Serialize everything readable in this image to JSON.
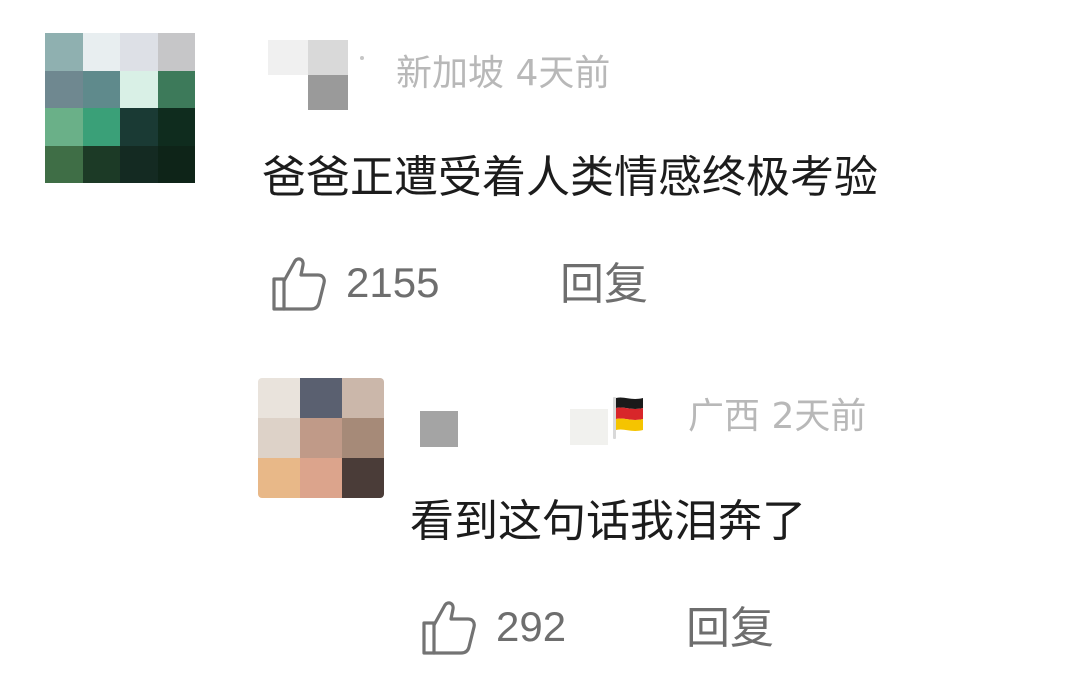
{
  "comments": [
    {
      "location": "新加坡",
      "time": "4天前",
      "text": "爸爸正遭受着人类情感终极考验",
      "likes": "2155",
      "reply_label": "回复"
    },
    {
      "location": "广西",
      "time": "2天前",
      "text": "看到这句话我泪奔了",
      "likes": "292",
      "reply_label": "回复"
    }
  ],
  "icons": {
    "like": "thumbs-up-icon",
    "flag": "germany-flag-icon"
  },
  "colors": {
    "meta_text": "#b8b8b8",
    "comment_text": "#1c1c1c",
    "action_text": "#6e6e6e"
  }
}
